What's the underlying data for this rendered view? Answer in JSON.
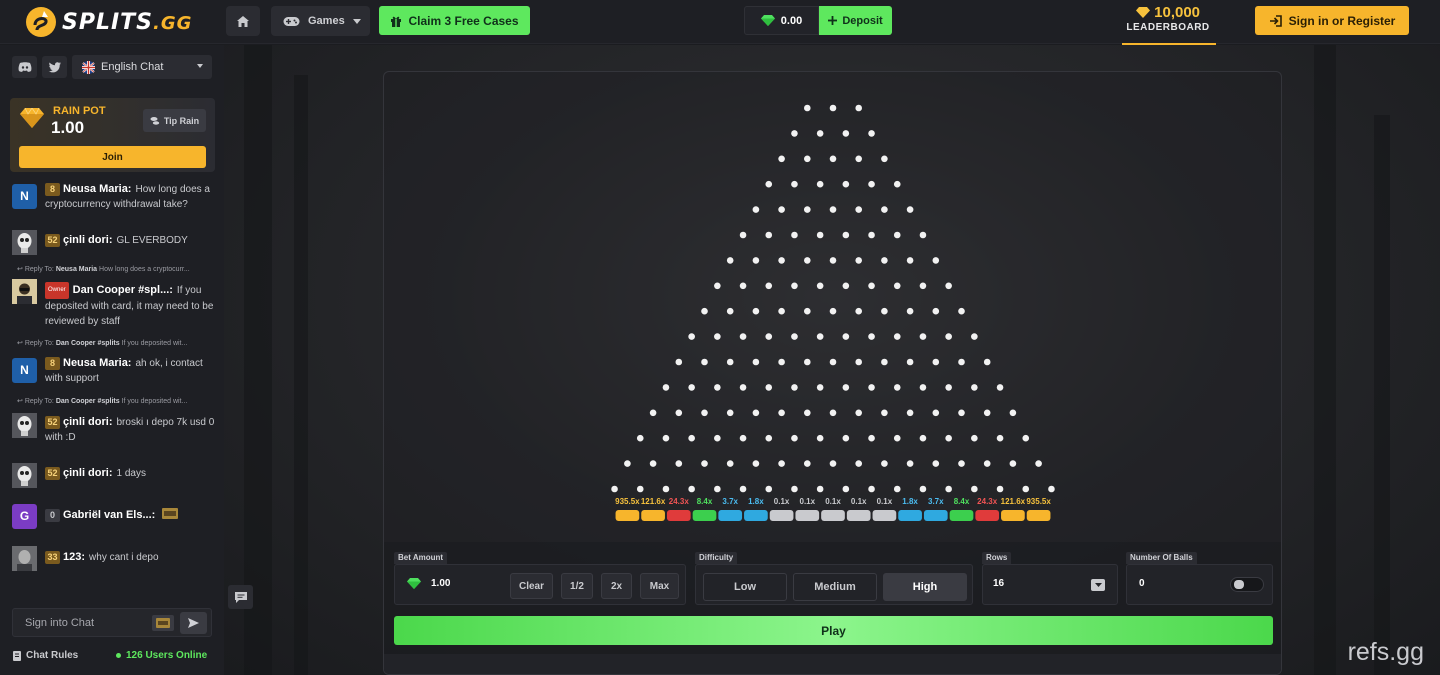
{
  "header": {
    "logo": {
      "name": "SPLITS",
      "suffix": ".GG"
    },
    "games_label": "Games",
    "claim_label": "Claim 3 Free Cases",
    "balance": "0.00",
    "deposit_label": "Deposit",
    "leaderboard": {
      "amount": "10,000",
      "label": "LEADERBOARD"
    },
    "signin_label": "Sign in or Register"
  },
  "sidebar": {
    "language": "English Chat",
    "rain": {
      "label": "RAIN POT",
      "value": "1.00",
      "tip_label": "Tip Rain",
      "join_label": "Join"
    },
    "messages": [
      {
        "avatar_letter": "N",
        "avatar_color": "#1f5fa8",
        "level": "8",
        "user": "Neusa Maria:",
        "text": "How long does a cryptocurrency withdrawal take?"
      },
      {
        "avatar_letter": "",
        "avatar_color": "#4a4b52",
        "level": "52",
        "user": "çinli dori:",
        "text": "GL EVERBODY"
      },
      {
        "reply_to": "Neusa Maria",
        "reply_text": "How long does a cryptocurr...",
        "avatar_letter": "",
        "avatar_color": "#8a6a3a",
        "badge": "Owner",
        "level": "",
        "user": "Dan Cooper #spl...:",
        "text": "If you deposited with card, it may need to be reviewed by staff"
      },
      {
        "reply_to": "Dan Cooper #splits",
        "reply_text": "If you deposited wit...",
        "avatar_letter": "N",
        "avatar_color": "#1f5fa8",
        "level": "8",
        "user": "Neusa Maria:",
        "text": "ah ok, i contact with support"
      },
      {
        "reply_to": "Dan Cooper #splits",
        "reply_text": "If you deposited wit...",
        "avatar_letter": "",
        "avatar_color": "#4a4b52",
        "level": "52",
        "user": "çinli dori:",
        "text": "broski ı depo 7k usd 0 with :D"
      },
      {
        "avatar_letter": "",
        "avatar_color": "#4a4b52",
        "level": "52",
        "user": "çinli dori:",
        "text": "1 days"
      },
      {
        "avatar_letter": "G",
        "avatar_color": "#7b3cc4",
        "level": "0",
        "user": "Gabriël van Els...:",
        "text": ""
      },
      {
        "avatar_letter": "",
        "avatar_color": "#5a5b5f",
        "level": "33",
        "user": "123:",
        "text": "why cant i depo"
      }
    ],
    "reply_prefix": "Reply To:",
    "chat_placeholder": "Sign into Chat",
    "chat_rules_label": "Chat Rules",
    "online_label": "126 Users Online"
  },
  "game": {
    "rows": 16,
    "multipliers": [
      "935.5x",
      "121.6x",
      "24.3x",
      "8.4x",
      "3.7x",
      "1.8x",
      "0.1x",
      "0.1x",
      "0.1x",
      "0.1x",
      "0.1x",
      "1.8x",
      "3.7x",
      "8.4x",
      "24.3x",
      "121.6x",
      "935.5x"
    ],
    "bucket_colors": [
      "#f7b52c",
      "#f7b52c",
      "#e03b3b",
      "#3ccf4e",
      "#2fa9e0",
      "#2fa9e0",
      "#c9cace",
      "#c9cace",
      "#c9cace",
      "#c9cace",
      "#c9cace",
      "#2fa9e0",
      "#2fa9e0",
      "#3ccf4e",
      "#e03b3b",
      "#f7b52c",
      "#f7b52c"
    ],
    "label_colors": [
      "#f7c23d",
      "#f7c23d",
      "#f05454",
      "#4fe05f",
      "#4bbcf0",
      "#4bbcf0",
      "#c9cace",
      "#c9cace",
      "#c9cace",
      "#c9cace",
      "#c9cace",
      "#4bbcf0",
      "#4bbcf0",
      "#4fe05f",
      "#f05454",
      "#f7c23d",
      "#f7c23d"
    ]
  },
  "controls": {
    "bet_amount_label": "Bet Amount",
    "bet_value": "1.00",
    "clear_label": "Clear",
    "half_label": "1/2",
    "double_label": "2x",
    "max_label": "Max",
    "difficulty_label": "Difficulty",
    "difficulties": [
      "Low",
      "Medium",
      "High"
    ],
    "rows_label": "Rows",
    "rows_value": "16",
    "balls_label": "Number Of Balls",
    "balls_value": "0",
    "play_label": "Play"
  },
  "watermark": "refs.gg"
}
